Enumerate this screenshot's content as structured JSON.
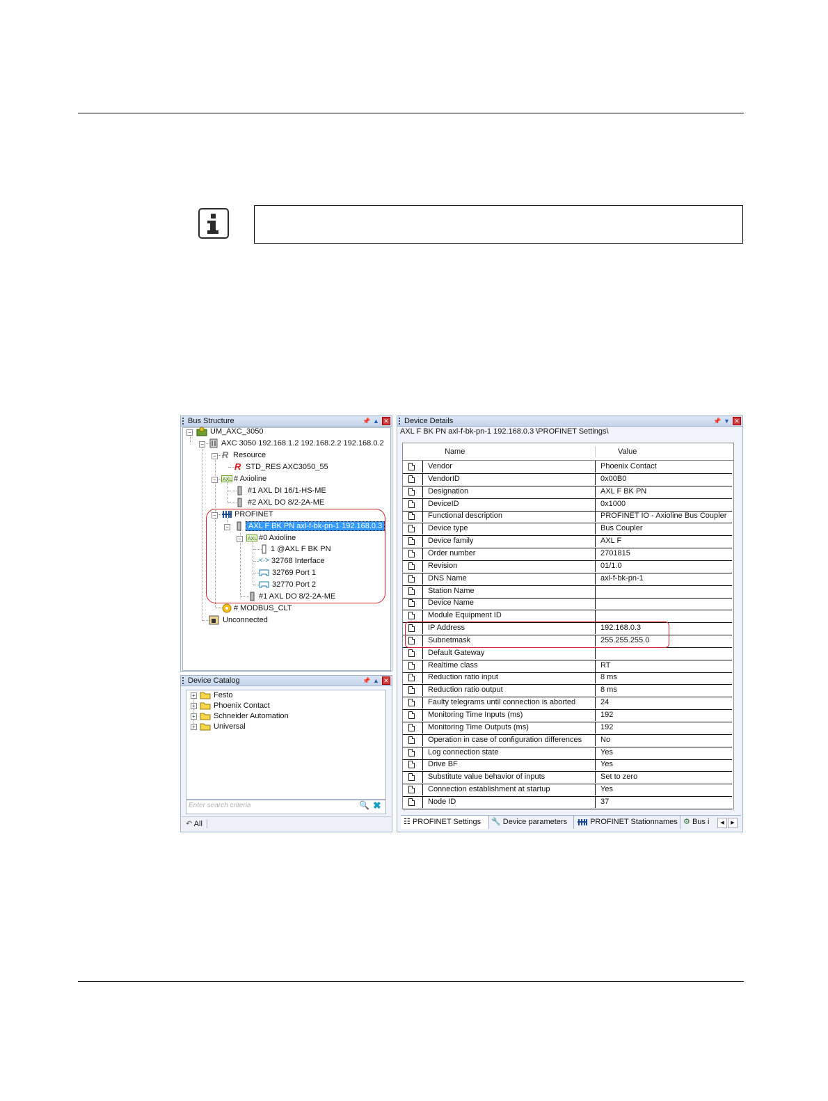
{
  "bus_structure": {
    "title": "Bus Structure",
    "items": [
      {
        "label": "UM_AXC_3050"
      },
      {
        "label": "AXC 3050 192.168.1.2 192.168.2.2 192.168.0.2"
      },
      {
        "label": "Resource"
      },
      {
        "label": "STD_RES AXC3050_55"
      },
      {
        "label": "# Axioline"
      },
      {
        "label": "#1 AXL DI 16/1-HS-ME"
      },
      {
        "label": "#2 AXL DO 8/2-2A-ME"
      },
      {
        "label": "PROFINET"
      },
      {
        "label": "AXL F BK PN axl-f-bk-pn-1 192.168.0.3"
      },
      {
        "label": "#0 Axioline"
      },
      {
        "label": "1 @AXL F BK PN"
      },
      {
        "label": "32768 Interface"
      },
      {
        "label": "32769 Port 1"
      },
      {
        "label": "32770 Port 2"
      },
      {
        "label": "#1 AXL DO 8/2-2A-ME"
      },
      {
        "label": "# MODBUS_CLT"
      },
      {
        "label": "Unconnected"
      }
    ]
  },
  "device_catalog": {
    "title": "Device Catalog",
    "items": [
      {
        "label": "Festo"
      },
      {
        "label": "Phoenix Contact"
      },
      {
        "label": "Schneider Automation"
      },
      {
        "label": "Universal"
      }
    ],
    "search_placeholder": "Enter search criteria",
    "filter_label": "All"
  },
  "device_details": {
    "title": "Device Details",
    "path": "AXL F BK PN axl-f-bk-pn-1 192.168.0.3 \\PROFINET Settings\\",
    "columns": [
      "Name",
      "Value"
    ],
    "rows": [
      {
        "name": "Vendor",
        "value": "Phoenix Contact"
      },
      {
        "name": "VendorID",
        "value": "0x00B0"
      },
      {
        "name": "Designation",
        "value": "AXL F BK PN"
      },
      {
        "name": "DeviceID",
        "value": "0x1000"
      },
      {
        "name": "Functional description",
        "value": "PROFINET IO - Axioline Bus Coupler"
      },
      {
        "name": "Device type",
        "value": "Bus Coupler"
      },
      {
        "name": "Device family",
        "value": "AXL F"
      },
      {
        "name": "Order number",
        "value": "2701815"
      },
      {
        "name": "Revision",
        "value": "01/1.0"
      },
      {
        "name": "DNS Name",
        "value": "axl-f-bk-pn-1"
      },
      {
        "name": "Station Name",
        "value": ""
      },
      {
        "name": "Device Name",
        "value": ""
      },
      {
        "name": "Module Equipment ID",
        "value": ""
      },
      {
        "name": "IP Address",
        "value": "192.168.0.3"
      },
      {
        "name": "Subnetmask",
        "value": "255.255.255.0"
      },
      {
        "name": "Default Gateway",
        "value": ""
      },
      {
        "name": "Realtime class",
        "value": "RT"
      },
      {
        "name": "Reduction ratio input",
        "value": "8 ms"
      },
      {
        "name": "Reduction ratio output",
        "value": "8 ms"
      },
      {
        "name": "Faulty telegrams until connection is aborted",
        "value": "24"
      },
      {
        "name": "Monitoring Time Inputs (ms)",
        "value": "192"
      },
      {
        "name": "Monitoring Time Outputs (ms)",
        "value": "192"
      },
      {
        "name": "Operation in case of configuration differences",
        "value": "No"
      },
      {
        "name": "Log connection state",
        "value": "Yes"
      },
      {
        "name": "Drive BF",
        "value": "Yes"
      },
      {
        "name": "Substitute value behavior of inputs",
        "value": "Set to zero"
      },
      {
        "name": "Connection establishment at startup",
        "value": "Yes"
      },
      {
        "name": "Node ID",
        "value": "37"
      }
    ],
    "tabs": [
      {
        "label": "PROFINET Settings"
      },
      {
        "label": "Device parameters"
      },
      {
        "label": "PROFINET Stationnames"
      },
      {
        "label": "Bus i"
      }
    ]
  }
}
